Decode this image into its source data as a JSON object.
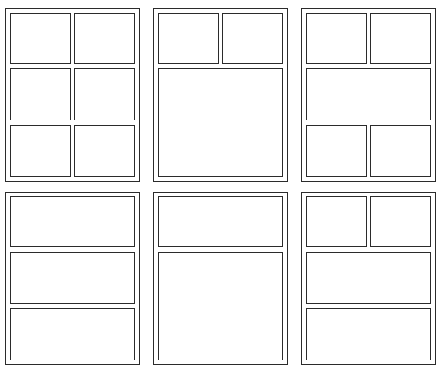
{
  "layout_picker": {
    "templates": [
      {
        "id": "grid-2x3",
        "panel_count": 6
      },
      {
        "id": "two-top-one-bottom",
        "panel_count": 3
      },
      {
        "id": "two-top-wide-two-bottom",
        "panel_count": 5
      },
      {
        "id": "three-rows",
        "panel_count": 3
      },
      {
        "id": "two-rows",
        "panel_count": 2
      },
      {
        "id": "two-top-two-rows",
        "panel_count": 4
      }
    ],
    "colors": {
      "border": "#2b2b2b",
      "panel_fill": "#ffffff",
      "background": "#ffffff"
    }
  }
}
